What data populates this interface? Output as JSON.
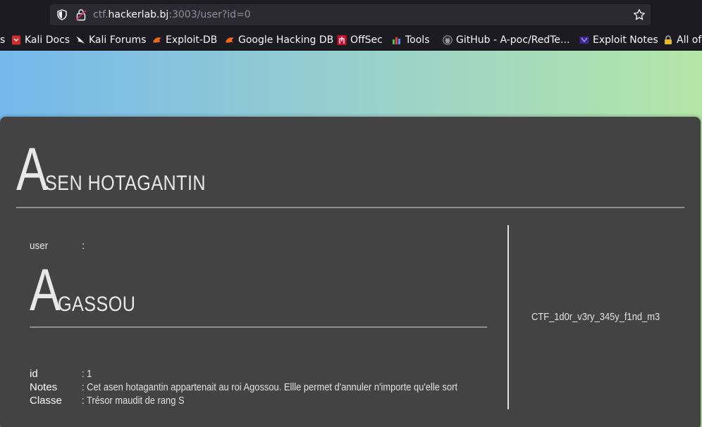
{
  "browser": {
    "url_prefix": "ctf.",
    "url_host": "hackerlab.bj",
    "url_suffix": ":3003/user?id=0"
  },
  "bookmarks": [
    {
      "label": "s",
      "icon": "kali-partial-icon"
    },
    {
      "label": "Kali Docs",
      "icon": "kali-docs-icon"
    },
    {
      "label": "Kali Forums",
      "icon": "kali-dragon-icon"
    },
    {
      "label": "Exploit-DB",
      "icon": "exploit-db-icon"
    },
    {
      "label": "Google Hacking DB",
      "icon": "ghdb-icon"
    },
    {
      "label": "OffSec",
      "icon": "offsec-icon"
    },
    {
      "label": "Tools",
      "icon": "tools-icon"
    },
    {
      "label": "GitHub - A-poc/RedTe...",
      "icon": "github-icon"
    },
    {
      "label": "Exploit Notes",
      "icon": "exploit-notes-icon"
    },
    {
      "label": "All of",
      "icon": "lock-bookmark-icon"
    }
  ],
  "card": {
    "title_initial": "A",
    "title_rest": "SEN HOTAGANTIN",
    "user_label": "user",
    "user_sep": ":",
    "owner_initial": "A",
    "owner_rest": "GASSOU",
    "fields": [
      {
        "key": "id",
        "value": ": 1"
      },
      {
        "key": "Notes",
        "value": ": Cet asen hotagantin appartenait au roi Agossou. Ellle permet d'annuler n'importe qu'elle sort"
      },
      {
        "key": "Classe",
        "value": ": Trésor maudit de rang S"
      }
    ],
    "flag": "CTF_1d0r_v3ry_345y_f1nd_m3"
  },
  "colors": {
    "gradient_start": "#74b8ec",
    "gradient_end": "#b4e6a8",
    "card_bg": "#434343",
    "browser_bg": "#1c1b22"
  }
}
